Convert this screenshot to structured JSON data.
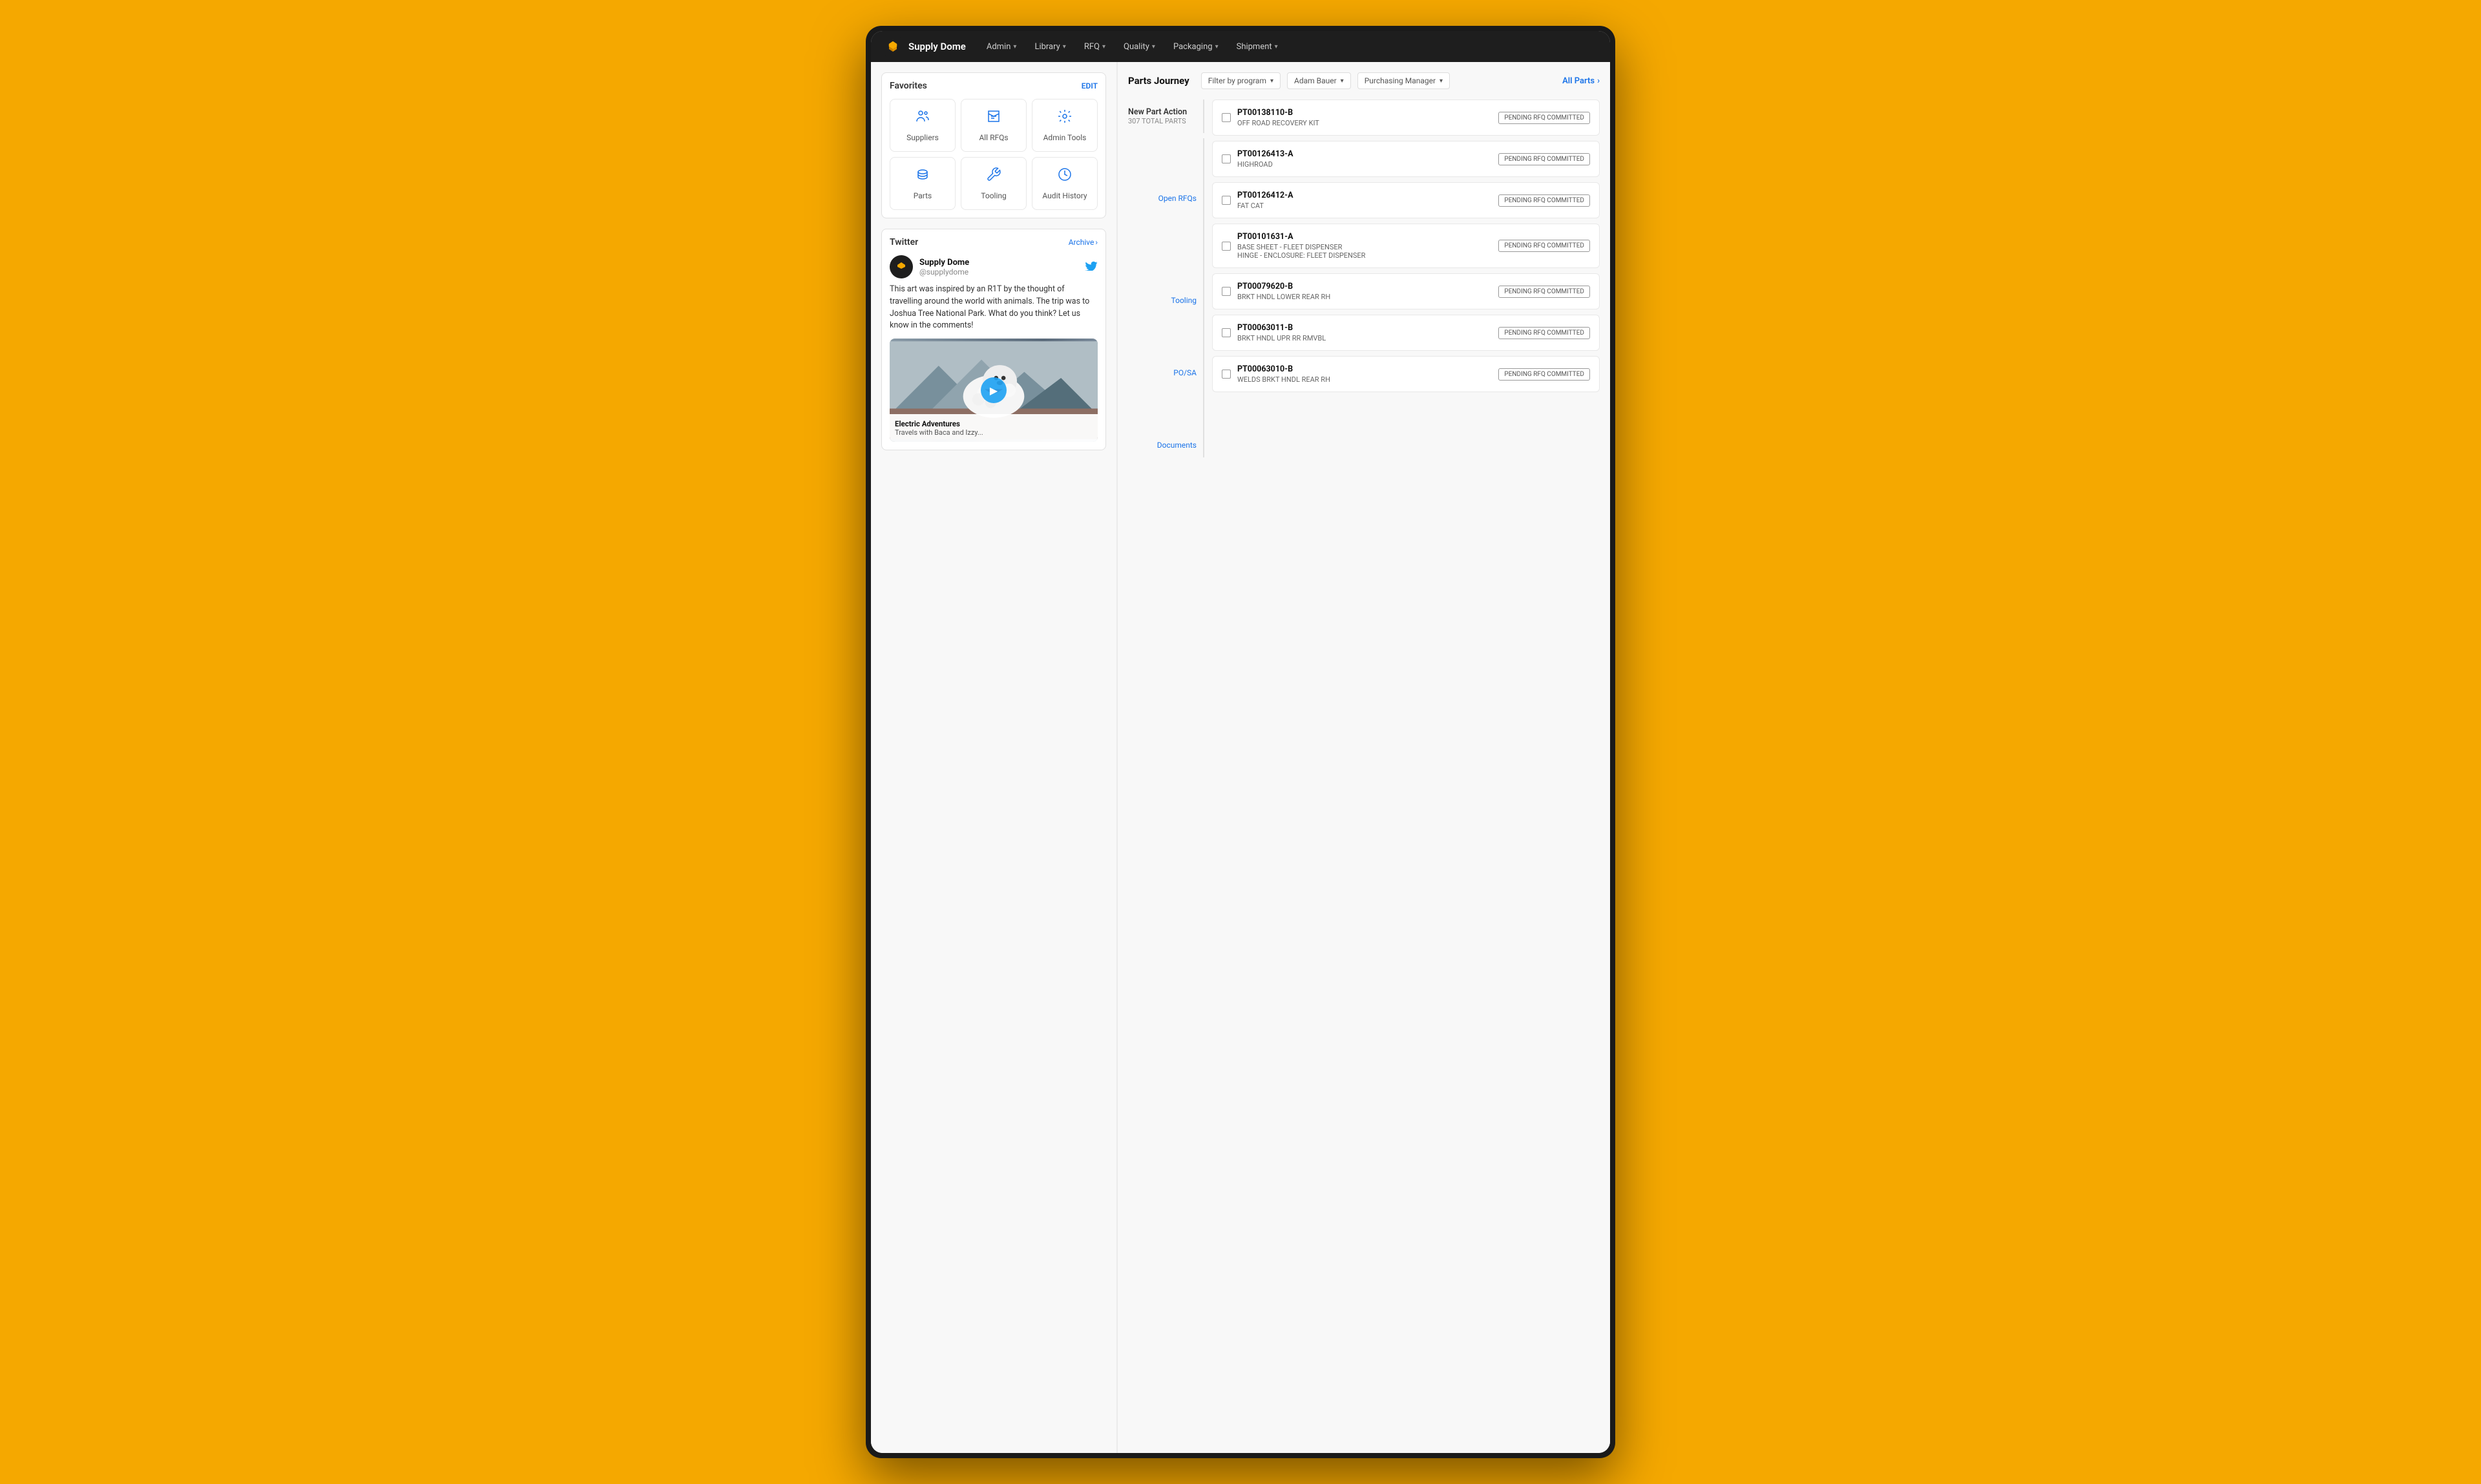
{
  "background_color": "#F5A800",
  "nav": {
    "logo_text": "Supply Dome",
    "items": [
      {
        "label": "Admin",
        "has_dropdown": true
      },
      {
        "label": "Library",
        "has_dropdown": true
      },
      {
        "label": "RFQ",
        "has_dropdown": true
      },
      {
        "label": "Quality",
        "has_dropdown": true
      },
      {
        "label": "Packaging",
        "has_dropdown": true
      },
      {
        "label": "Shipment",
        "has_dropdown": true
      }
    ]
  },
  "left_panel": {
    "favorites": {
      "title": "Favorites",
      "edit_label": "EDIT",
      "items": [
        {
          "label": "Suppliers",
          "icon": "👤"
        },
        {
          "label": "All RFQs",
          "icon": "📦"
        },
        {
          "label": "Admin Tools",
          "icon": "🔧"
        },
        {
          "label": "Parts",
          "icon": "🗃️"
        },
        {
          "label": "Tooling",
          "icon": "🔨"
        },
        {
          "label": "Audit History",
          "icon": "🕐"
        }
      ]
    },
    "twitter": {
      "title": "Twitter",
      "archive_label": "Archive",
      "tweet": {
        "author_name": "Supply Dome",
        "author_handle": "@supplydome",
        "text": "This art was inspired by an R1T by the thought of travelling around the world with animals. The trip was to Joshua Tree National Park. What do you think? Let us know in the comments!",
        "image_caption_title": "Electric Adventures",
        "image_caption_sub": "Travels with Baca and Izzy..."
      }
    }
  },
  "right_panel": {
    "parts_journey": {
      "title": "Parts Journey",
      "filters": [
        {
          "label": "Filter by program",
          "value": ""
        },
        {
          "label": "Adam Bauer",
          "value": ""
        },
        {
          "label": "Purchasing Manager",
          "value": ""
        }
      ],
      "all_parts_label": "All Parts"
    },
    "new_part_action": {
      "title": "New Part Action",
      "total_label": "307 TOTAL PARTS"
    },
    "stages": [
      {
        "label": "Open RFQs"
      },
      {
        "label": "Tooling"
      },
      {
        "label": "PO/SA"
      },
      {
        "label": "Documents"
      }
    ],
    "parts": [
      {
        "number": "PT00138110-B",
        "name": "OFF ROAD RECOVERY KIT",
        "status": "PENDING RFQ COMMITTED"
      },
      {
        "number": "PT00126413-A",
        "name": "HIGHROAD",
        "status": "PENDING RFQ COMMITTED"
      },
      {
        "number": "PT00126412-A",
        "name": "FAT CAT",
        "status": "PENDING RFQ COMMITTED"
      },
      {
        "number": "PT00101631-A",
        "name": "BASE SHEET - FLEET DISPENSER",
        "name2": "HINGE - ENCLOSURE: FLEET DISPENSER",
        "status": "PENDING RFQ COMMITTED"
      },
      {
        "number": "PT00079620-B",
        "name": "BRKT HNDL LOWER REAR RH",
        "status": "PENDING RFQ COMMITTED"
      },
      {
        "number": "PT00063011-B",
        "name": "BRKT HNDL UPR RR RMVBL",
        "status": "PENDING RFQ COMMITTED"
      },
      {
        "number": "PT00063010-B",
        "name": "WELDS BRKT HNDL REAR RH",
        "status": "PENDING RFQ COMMITTED"
      }
    ]
  }
}
